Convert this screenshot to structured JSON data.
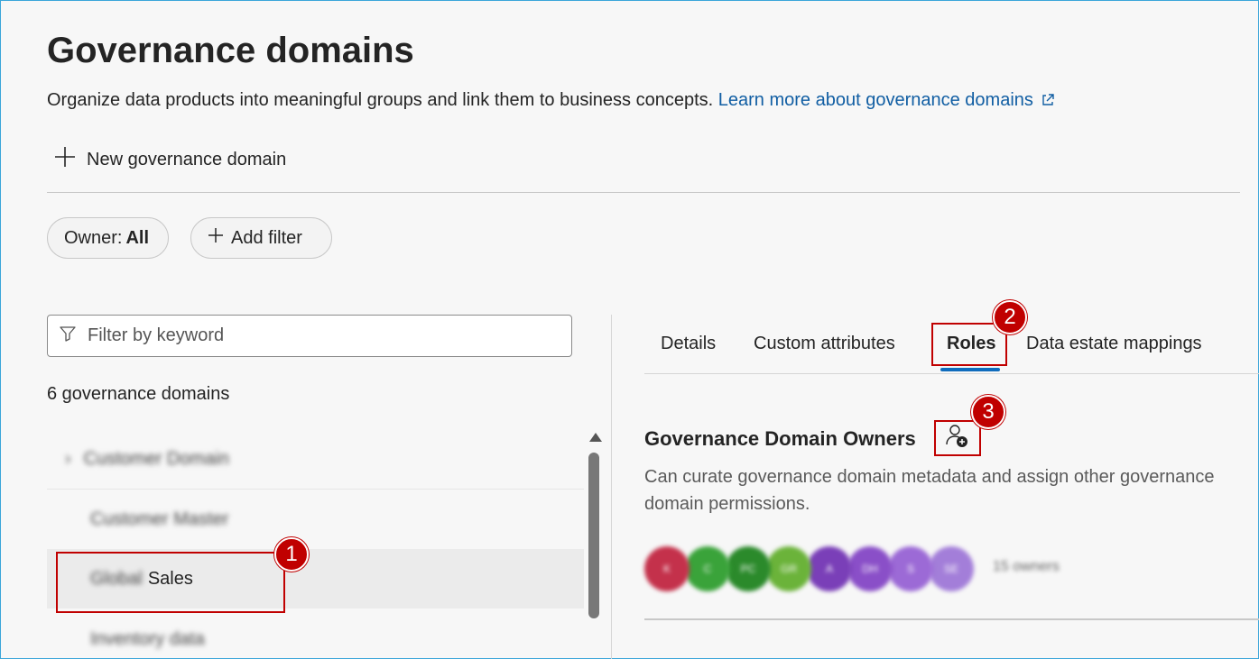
{
  "header": {
    "title": "Governance domains",
    "subtitle": "Organize data products into meaningful groups and link them to business concepts.",
    "learn_more_link": "Learn more about governance domains"
  },
  "toolbar": {
    "new_domain_label": "New governance domain"
  },
  "filters": {
    "owner_label": "Owner:",
    "owner_value": "All",
    "add_filter_label": "Add filter"
  },
  "list_panel": {
    "search_placeholder": "Filter by keyword",
    "count_label": "6 governance domains",
    "items": [
      {
        "label": "Customer Domain",
        "blurred": true,
        "has_chevron": true
      },
      {
        "label": "Customer Master",
        "blurred": true
      },
      {
        "prefix": "Global",
        "label": "Sales",
        "selected": true
      },
      {
        "label": "Inventory data",
        "blurred": true
      }
    ]
  },
  "detail_panel": {
    "tabs": [
      {
        "label": "Details"
      },
      {
        "label": "Custom attributes"
      },
      {
        "label": "Roles",
        "active": true
      },
      {
        "label": "Data estate mappings"
      }
    ],
    "role": {
      "title": "Governance Domain Owners",
      "description": "Can curate governance domain metadata and assign other governance domain permissions.",
      "owners_count": "15 owners",
      "avatars": [
        {
          "initials": "K",
          "color": "#c4314b"
        },
        {
          "initials": "C",
          "color": "#3aa33a"
        },
        {
          "initials": "PC",
          "color": "#2b8a2b"
        },
        {
          "initials": "GR",
          "color": "#6bb33a"
        },
        {
          "initials": "A",
          "color": "#7a3fb8"
        },
        {
          "initials": "DH",
          "color": "#8a4fc8"
        },
        {
          "initials": "S",
          "color": "#9c6ad6"
        },
        {
          "initials": "SE",
          "color": "#a37ed9"
        }
      ]
    }
  },
  "callouts": [
    "1",
    "2",
    "3"
  ]
}
